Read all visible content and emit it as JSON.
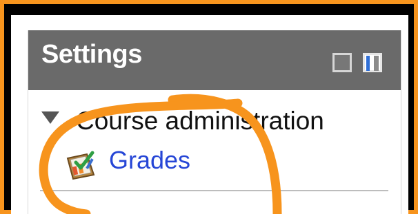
{
  "colors": {
    "frame_border": "#f7941d",
    "header_background": "#6a6a6a",
    "link": "#2646d6",
    "annotation_stroke": "#f7941d"
  },
  "settings_block": {
    "title": "Settings",
    "hide_control_icon": "hide-block-icon",
    "dock_control_icon": "dock-block-icon"
  },
  "tree": {
    "section_label": "Course administration",
    "section_icon": "triangle-down-icon",
    "items": [
      {
        "label": "Grades",
        "icon": "grades-icon"
      }
    ]
  },
  "annotation": {
    "shape": "hand-drawn circle",
    "color": "#f7941d",
    "target": "Grades"
  }
}
